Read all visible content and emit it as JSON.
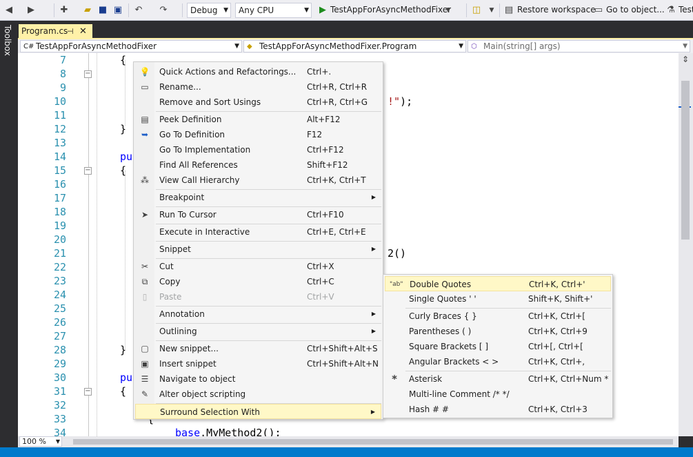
{
  "toolbar": {
    "config": "Debug",
    "platform": "Any CPU",
    "start_target": "TestAppForAsyncMethodFixer",
    "restore_workspace": "Restore workspace",
    "go_to_object": "Go to object...",
    "test": "Test"
  },
  "toolbox": {
    "label": "Toolbox"
  },
  "tab": {
    "title": "Program.cs",
    "pin": "⊣",
    "close": "✕"
  },
  "navbar": {
    "project": "TestAppForAsyncMethodFixer",
    "class": "TestAppForAsyncMethodFixer.Program",
    "member": "Main(string[] args)",
    "project_icon": "C#"
  },
  "editor": {
    "line_numbers": [
      "7",
      "8",
      "9",
      "10",
      "11",
      "12",
      "13",
      "14",
      "15",
      "16",
      "17",
      "18",
      "19",
      "20",
      "21",
      "22",
      "23",
      "24",
      "25",
      "26",
      "27",
      "28",
      "29",
      "30",
      "31",
      "32",
      "33",
      "34"
    ],
    "lines": {
      "l7": "{",
      "l10_str": "!\"",
      "l10_tail": ");",
      "l12": "}",
      "l14_kw": "pu",
      "l15": "{",
      "l21": "2()",
      "l28": "}",
      "l30_kw": "pu",
      "l31": "{",
      "l32": "{",
      "l34_kw": "base",
      "l34_tail": ".MyMethod2();"
    }
  },
  "zoom": {
    "value": "100 %"
  },
  "context_menu": {
    "items": [
      {
        "label": "Quick Actions and Refactorings...",
        "shortcut": "Ctrl+.",
        "icon": "lightbulb-icon"
      },
      {
        "label": "Rename...",
        "shortcut": "Ctrl+R, Ctrl+R",
        "icon": "rename-icon"
      },
      {
        "label": "Remove and Sort Usings",
        "shortcut": "Ctrl+R, Ctrl+G"
      },
      {
        "label": "Peek Definition",
        "shortcut": "Alt+F12",
        "icon": "peek-icon"
      },
      {
        "label": "Go To Definition",
        "shortcut": "F12",
        "icon": "goto-definition-icon"
      },
      {
        "label": "Go To Implementation",
        "shortcut": "Ctrl+F12"
      },
      {
        "label": "Find All References",
        "shortcut": "Shift+F12"
      },
      {
        "label": "View Call Hierarchy",
        "shortcut": "Ctrl+K, Ctrl+T",
        "icon": "call-hierarchy-icon"
      },
      {
        "label": "Breakpoint",
        "shortcut": ""
      },
      {
        "label": "Run To Cursor",
        "shortcut": "Ctrl+F10",
        "icon": "cursor-icon"
      },
      {
        "label": "Execute in Interactive",
        "shortcut": "Ctrl+E, Ctrl+E"
      },
      {
        "label": "Snippet",
        "shortcut": ""
      },
      {
        "label": "Cut",
        "shortcut": "Ctrl+X",
        "icon": "scissors-icon"
      },
      {
        "label": "Copy",
        "shortcut": "Ctrl+C",
        "icon": "copy-icon"
      },
      {
        "label": "Paste",
        "shortcut": "Ctrl+V",
        "icon": "paste-icon"
      },
      {
        "label": "Annotation",
        "shortcut": ""
      },
      {
        "label": "Outlining",
        "shortcut": ""
      },
      {
        "label": "New snippet...",
        "shortcut": "Ctrl+Shift+Alt+S",
        "icon": "new-snippet-icon"
      },
      {
        "label": "Insert snippet",
        "shortcut": "Ctrl+Shift+Alt+N",
        "icon": "insert-snippet-icon"
      },
      {
        "label": "Navigate to object",
        "shortcut": "",
        "icon": "navigate-icon"
      },
      {
        "label": "Alter object scripting",
        "shortcut": "",
        "icon": "script-icon"
      },
      {
        "label": "Surround Selection With",
        "shortcut": ""
      }
    ]
  },
  "submenu": {
    "items": [
      {
        "label": "Double Quotes",
        "shortcut": "Ctrl+K, Ctrl+'",
        "icon_text": "\"ab\""
      },
      {
        "label": "Single Quotes ' '",
        "shortcut": "Shift+K, Shift+'"
      },
      {
        "label": "Curly Braces { }",
        "shortcut": "Ctrl+K, Ctrl+["
      },
      {
        "label": "Parentheses ( )",
        "shortcut": "Ctrl+K, Ctrl+9"
      },
      {
        "label": "Square Brackets [ ]",
        "shortcut": "Ctrl+[, Ctrl+["
      },
      {
        "label": "Angular Brackets < >",
        "shortcut": "Ctrl+K, Ctrl+,"
      },
      {
        "label": "Asterisk",
        "shortcut": "Ctrl+K, Ctrl+Num *",
        "icon_text": "*"
      },
      {
        "label": "Multi-line Comment /* */",
        "shortcut": ""
      },
      {
        "label": "Hash # #",
        "shortcut": "Ctrl+K, Ctrl+3"
      }
    ]
  }
}
